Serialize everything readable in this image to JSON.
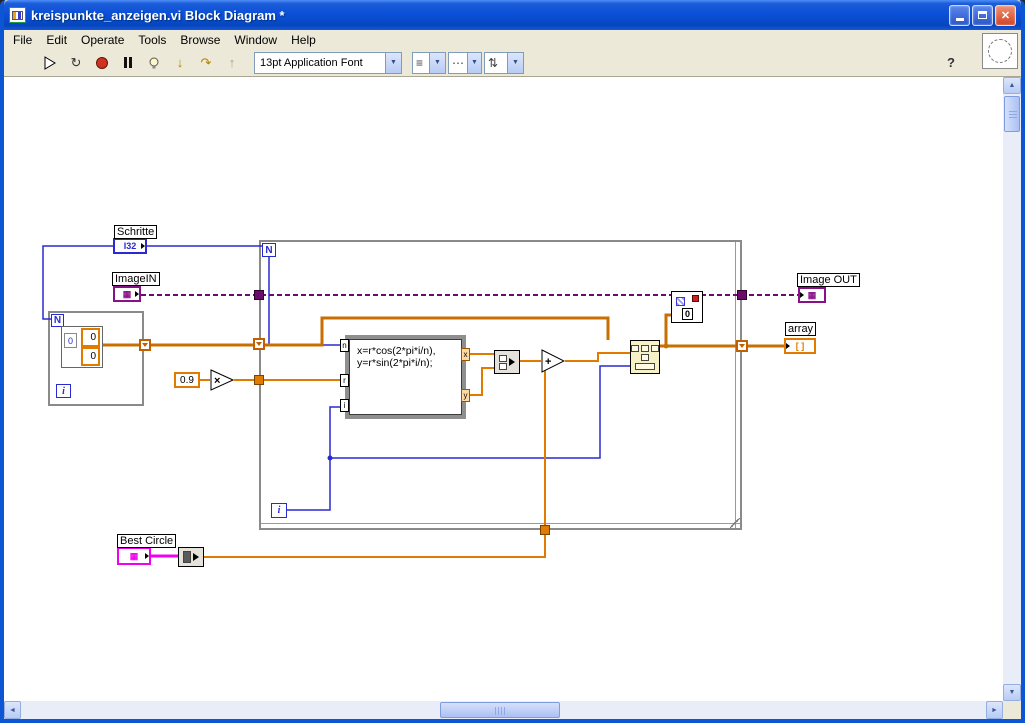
{
  "window": {
    "title": "kreispunkte_anzeigen.vi Block Diagram *",
    "close_glyph": "✕"
  },
  "menu": {
    "items": [
      "File",
      "Edit",
      "Operate",
      "Tools",
      "Browse",
      "Window",
      "Help"
    ]
  },
  "toolbar": {
    "font_selector": "13pt Application Font",
    "help_label": "?"
  },
  "icons": {
    "run_continuous": "↻",
    "step_into": "↓",
    "step_over": "↷",
    "step_out": "↑",
    "align_objects": "≡",
    "distribute_objects": "⋯",
    "reorder": "⇅",
    "dropdown_arrow": "▼",
    "scroll_up": "▲",
    "scroll_down": "▼",
    "scroll_left": "◄",
    "scroll_right": "►"
  },
  "diagram": {
    "schritte": {
      "label": "Schritte",
      "type_text": "I32"
    },
    "imagein": {
      "label": "ImageIN",
      "glyph": "▦"
    },
    "imageout": {
      "label": "Image OUT",
      "glyph": "▦"
    },
    "array_out": {
      "label": "array",
      "glyph": "[ ]"
    },
    "best_circle": {
      "label": "Best Circle",
      "glyph": "▦"
    },
    "constant": {
      "value": "0.9"
    },
    "multiply_glyph": "×",
    "add_glyph": "+",
    "formula": {
      "line1": "x=r*cos(2*pi*i/n),",
      "line2": "y=r*sin(2*pi*i/n);",
      "in_n": "n",
      "in_r": "r",
      "in_i": "i",
      "out_x": "x",
      "out_y": "y"
    },
    "loop_count": "N",
    "loop_iterator": "i",
    "left_array": {
      "index": "0",
      "value1": "0",
      "value2": "0"
    },
    "overlay_index": "0"
  },
  "colors": {
    "integer_wire": "#2a2ad2",
    "float_wire": "#e07b00",
    "image_wire": "#6a0d6a",
    "cluster_wire": "#f000f0",
    "titlebar_blue": "#0b50d8",
    "stop_red": "#cc3322"
  }
}
